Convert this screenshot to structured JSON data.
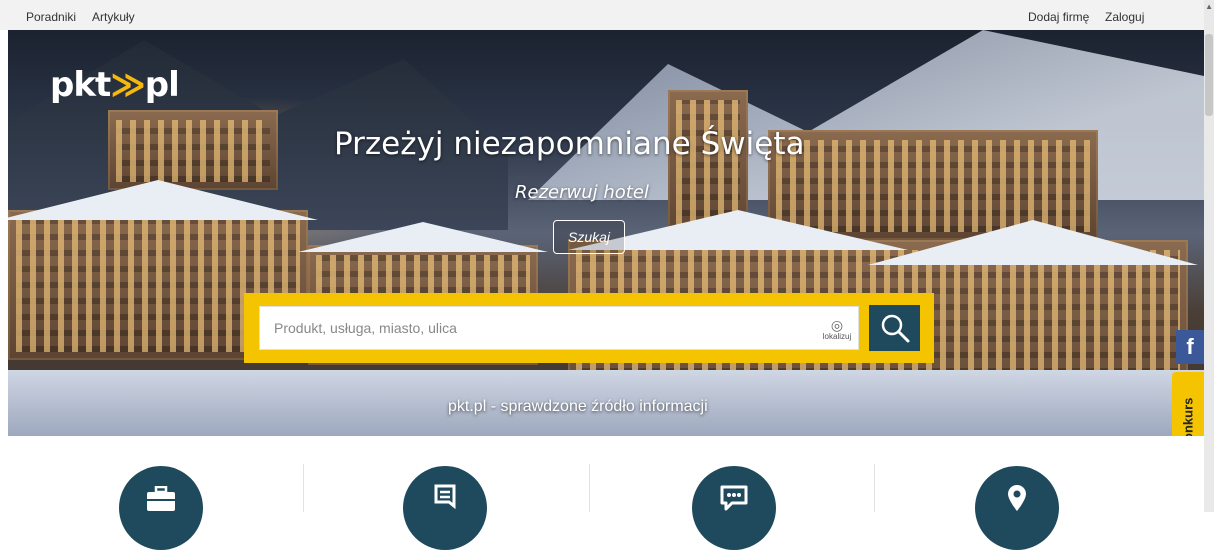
{
  "topbar": {
    "left": [
      "Poradniki",
      "Artykuły"
    ],
    "right": [
      "Dodaj firmę",
      "Zaloguj"
    ]
  },
  "hero": {
    "logo": {
      "pre": "pkt",
      "post": "pl"
    },
    "title": "Przeżyj niezapomniane Święta",
    "subtitle": "Rezerwuj hotel",
    "cta": "Szukaj",
    "tagline": "pkt.pl - sprawdzone źródło informacji"
  },
  "search": {
    "placeholder": "Produkt, usługa, miasto, ulica",
    "locate_label": "lokalizuj"
  },
  "side": {
    "facebook": "f",
    "konkurs": "Konkurs"
  },
  "features": {
    "icons": [
      "briefcase-icon",
      "bookmark-document-icon",
      "chat-bubble-icon",
      "map-pin-icon"
    ]
  },
  "colors": {
    "accent": "#f5c400",
    "primary": "#1f4a5e",
    "facebook": "#3b5998"
  }
}
